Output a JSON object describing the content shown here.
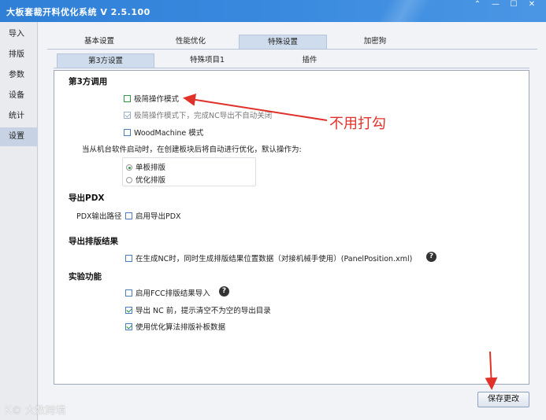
{
  "window": {
    "title": "大板套裁开料优化系统 V 2.5.100",
    "controls": [
      "⌃",
      "—",
      "☐",
      "✕"
    ]
  },
  "sidebar": {
    "items": [
      {
        "label": "导入"
      },
      {
        "label": "排版"
      },
      {
        "label": "参数"
      },
      {
        "label": "设备"
      },
      {
        "label": "统计"
      },
      {
        "label": "设置",
        "active": true
      }
    ]
  },
  "top_tabs": [
    {
      "label": "基本设置"
    },
    {
      "label": "性能优化"
    },
    {
      "label": "特殊设置",
      "active": true
    },
    {
      "label": "加密狗"
    }
  ],
  "sub_tabs": [
    {
      "label": "第3方设置",
      "active": true
    },
    {
      "label": "特殊项目1"
    },
    {
      "label": "插件"
    }
  ],
  "third_party": {
    "heading": "第3方调用",
    "opt_simple_mode": "极简操作模式",
    "opt_nc_no_close": "极简操作模式下，完成NC导出不自动关闭",
    "opt_woodmachine": "WoodMachine 模式",
    "startup_text": "当从机台软件启动时，在创建板块后将自动进行优化，默认操作为:",
    "radio_single": "单板排版",
    "radio_optimize": "优化排版"
  },
  "export_pdx": {
    "heading": "导出PDX",
    "path_label": "PDX输出路径",
    "opt_enable": "启用导出PDX"
  },
  "export_result": {
    "heading": "导出排版结果",
    "opt_panel_position": "在生成NC时，同时生成排版结果位置数据（对接机械手使用）(PanelPosition.xml)"
  },
  "experimental": {
    "heading": "实验功能",
    "opt_fcc": "启用FCC排版结果导入",
    "opt_clear_dir": "导出 NC 前，提示清空不为空的导出目录",
    "opt_fill_data": "使用优化算法排版补板数据"
  },
  "help_glyph": "?",
  "save_button": "保存更改",
  "annotation_text": "不用打勾",
  "watermark": "K© 大数跨境",
  "colors": {
    "titlebar": "#2f7fd6",
    "annotation_red": "#e0322a",
    "active_tab": "#cfdced",
    "check_green": "#1a8f3a"
  }
}
